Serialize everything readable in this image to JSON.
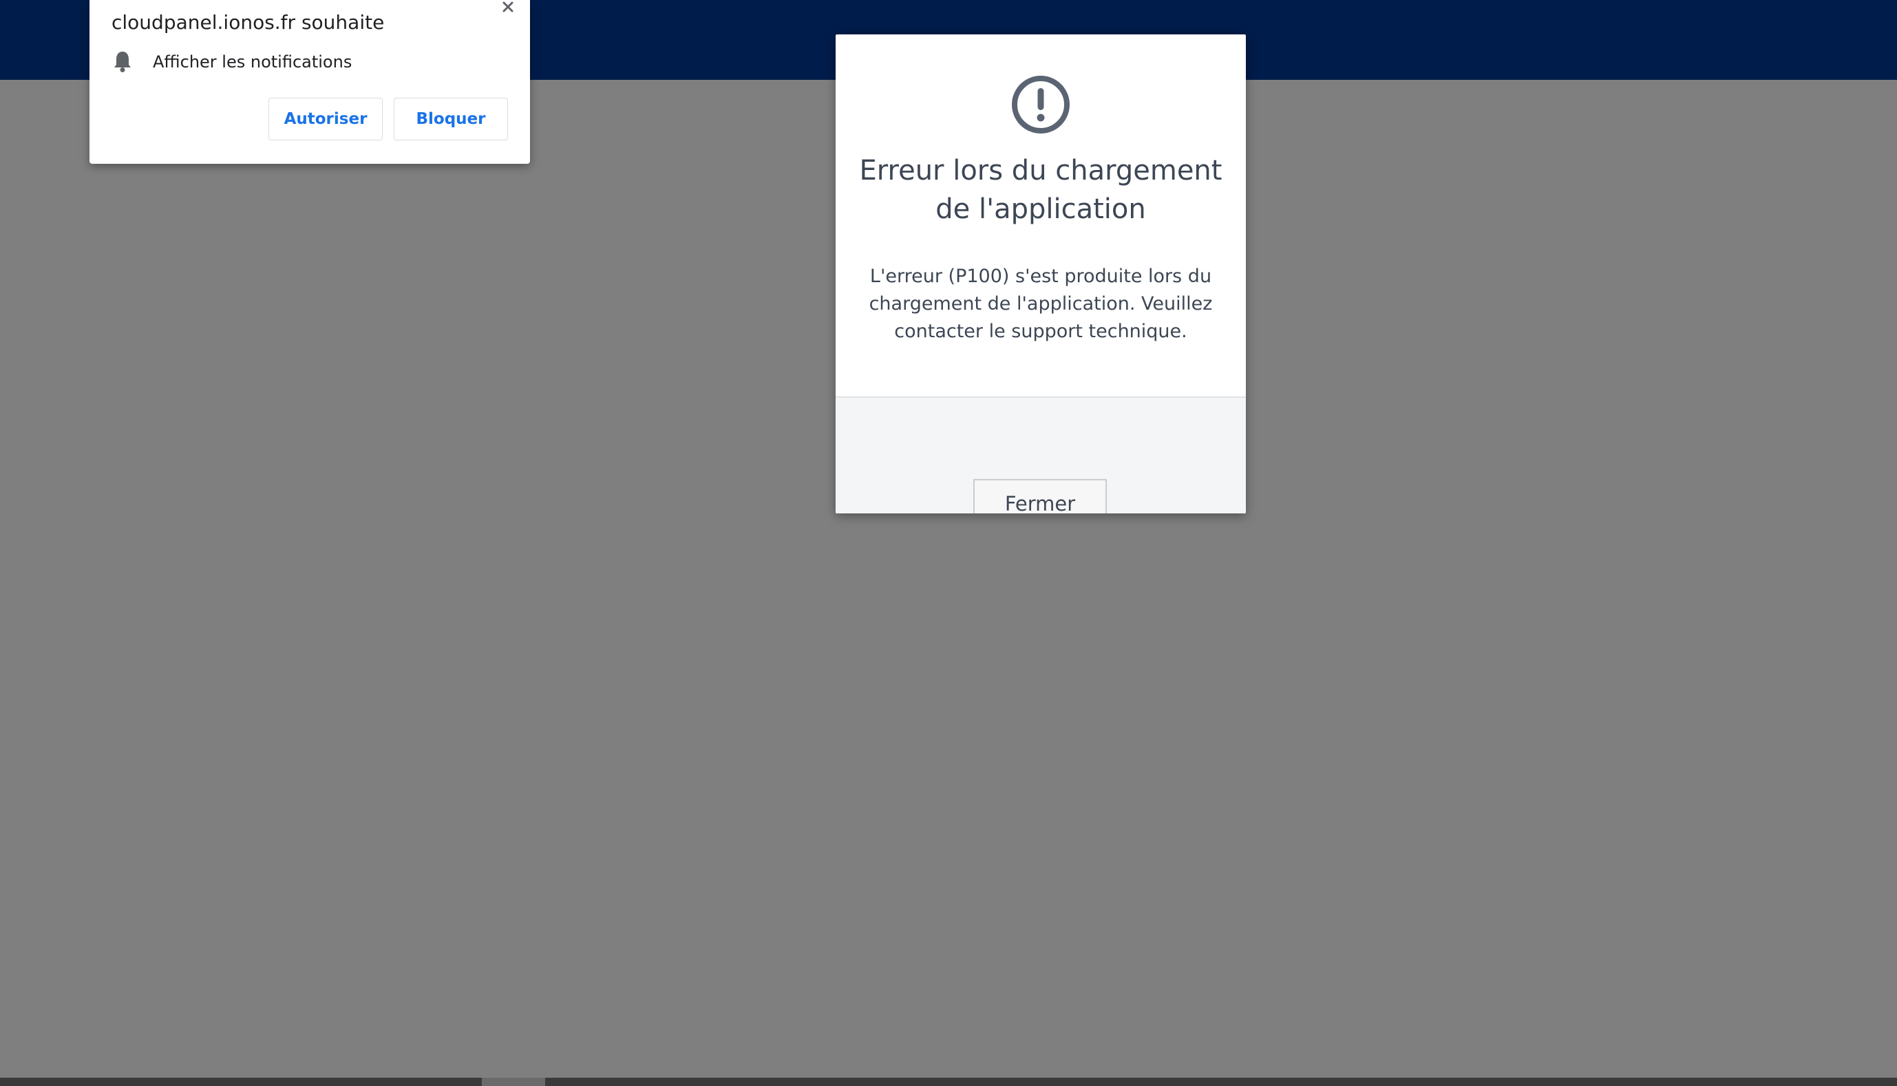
{
  "notification_prompt": {
    "title": "cloudpanel.ionos.fr souhaite",
    "permission_text": "Afficher les notifications",
    "allow_label": "Autoriser",
    "block_label": "Bloquer",
    "icons": {
      "close": "close-icon",
      "bell": "bell-icon"
    }
  },
  "error_dialog": {
    "icon": "exclamation-circle-icon",
    "title": "Erreur lors du chargement de l'application",
    "message": "L'erreur (P100) s'est produite lors du chargement de l'application. Veuillez contacter le support technique.",
    "close_label": "Fermer"
  },
  "colors": {
    "header_bg": "#001c4a",
    "overlay_bg": "#7f7f7f",
    "link_blue": "#1a73e8",
    "text_dark": "#3d4654"
  }
}
